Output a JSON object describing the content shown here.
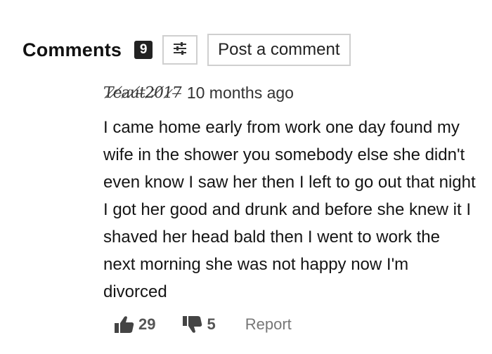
{
  "header": {
    "title": "Comments",
    "count": "9",
    "post_button_label": "Post a comment"
  },
  "icons": {
    "filter": "sliders-icon",
    "like": "thumbs-up-icon",
    "dislike": "thumbs-down-icon"
  },
  "comment": {
    "username": "T̷e̸a̷u̸t̶2̷0̸1̷7̶",
    "timestamp": "10 months ago",
    "text": "I came home early from work one day found my wife in the shower you somebody else she didn't even know I saw her then I left to go out that night I got her good and drunk and before she knew it I shaved her head bald then I went to work the next morning she was not happy now I'm divorced",
    "likes": "29",
    "dislikes": "5",
    "report_label": "Report"
  }
}
